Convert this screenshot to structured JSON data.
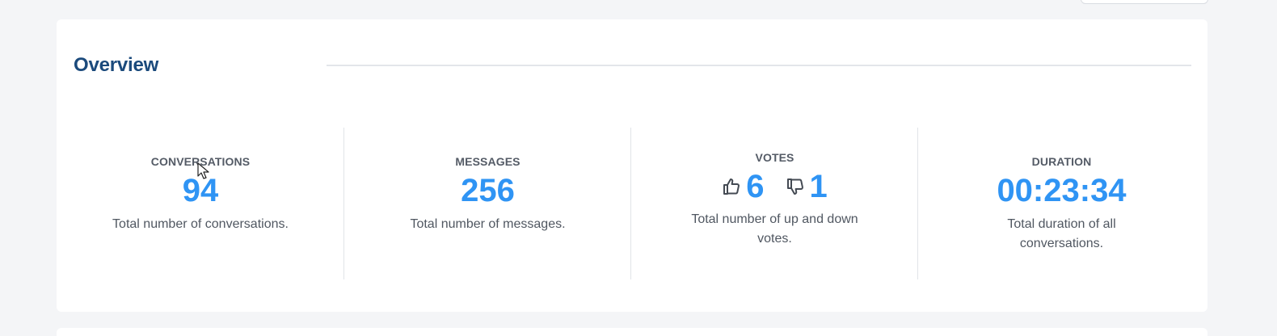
{
  "overview": {
    "title": "Overview"
  },
  "stats": [
    {
      "label": "CONVERSATIONS",
      "value": "94",
      "description": "Total number of conversations."
    },
    {
      "label": "MESSAGES",
      "value": "256",
      "description": "Total number of messages."
    },
    {
      "label": "VOTES",
      "up_votes": "6",
      "down_votes": "1",
      "up_icon": "thumbs-up-icon",
      "down_icon": "thumbs-down-icon",
      "description": "Total number of up and down votes."
    },
    {
      "label": "DURATION",
      "value": "00:23:34",
      "description": "Total duration of all conversations."
    }
  ],
  "colors": {
    "title": "#1b4a7c",
    "accent": "#2f94f4",
    "label": "#545b66",
    "text": "#505761",
    "background": "#f4f5f7",
    "card": "#ffffff"
  }
}
